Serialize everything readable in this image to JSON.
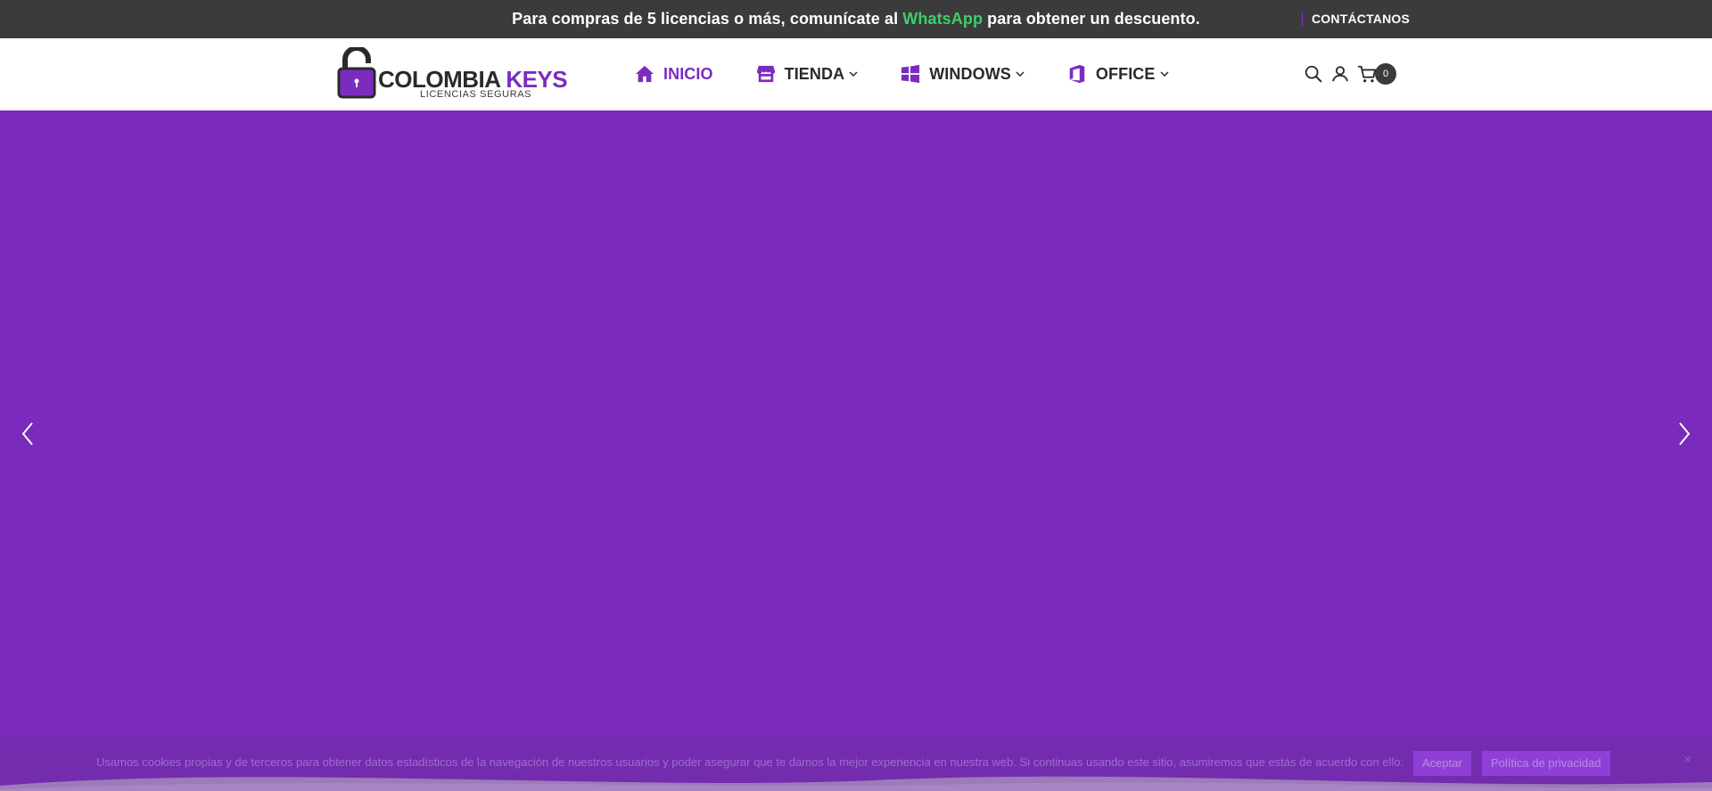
{
  "topbar": {
    "message_before": "Para compras de 5 licencias o más, comunícate al ",
    "message_link": "WhatsApp",
    "message_after": " para obtener un descuento.",
    "contact_label": "CONTÁCTANOS"
  },
  "header": {
    "logo": {
      "brand_main": "COLOMBIA",
      "brand_accent": "KEYS",
      "tagline": "LICENCIAS SEGURAS"
    },
    "nav": [
      {
        "label": "INICIO",
        "icon": "home-icon",
        "active": true
      },
      {
        "label": "TIENDA",
        "icon": "store-icon",
        "dropdown": true
      },
      {
        "label": "WINDOWS",
        "icon": "windows-icon",
        "dropdown": true
      },
      {
        "label": "OFFICE",
        "icon": "office-icon",
        "dropdown": true
      }
    ],
    "icons": [
      "search-icon",
      "user-icon",
      "cart-icon"
    ],
    "cart_count": "0"
  },
  "hero": {
    "background_color": "#7a2bbd",
    "prev_icon": "chevron-left-icon",
    "next_icon": "chevron-right-icon"
  },
  "cookie_banner": {
    "text": "Usamos cookies propias y de terceros para obtener datos estadísticos de la navegación de nuestros usuarios y poder asegurar que te damos la mejor experiencia en nuestra web. Si continuas usando este sitio, asumiremos que estás de acuerdo con ello.",
    "accept_label": "Aceptar",
    "policy_label": "Política de privacidad",
    "close_label": "×"
  },
  "colors": {
    "accent": "#7b2cbf",
    "topbar_bg": "#3b3b3b",
    "whatsapp": "#3ecf6a"
  }
}
